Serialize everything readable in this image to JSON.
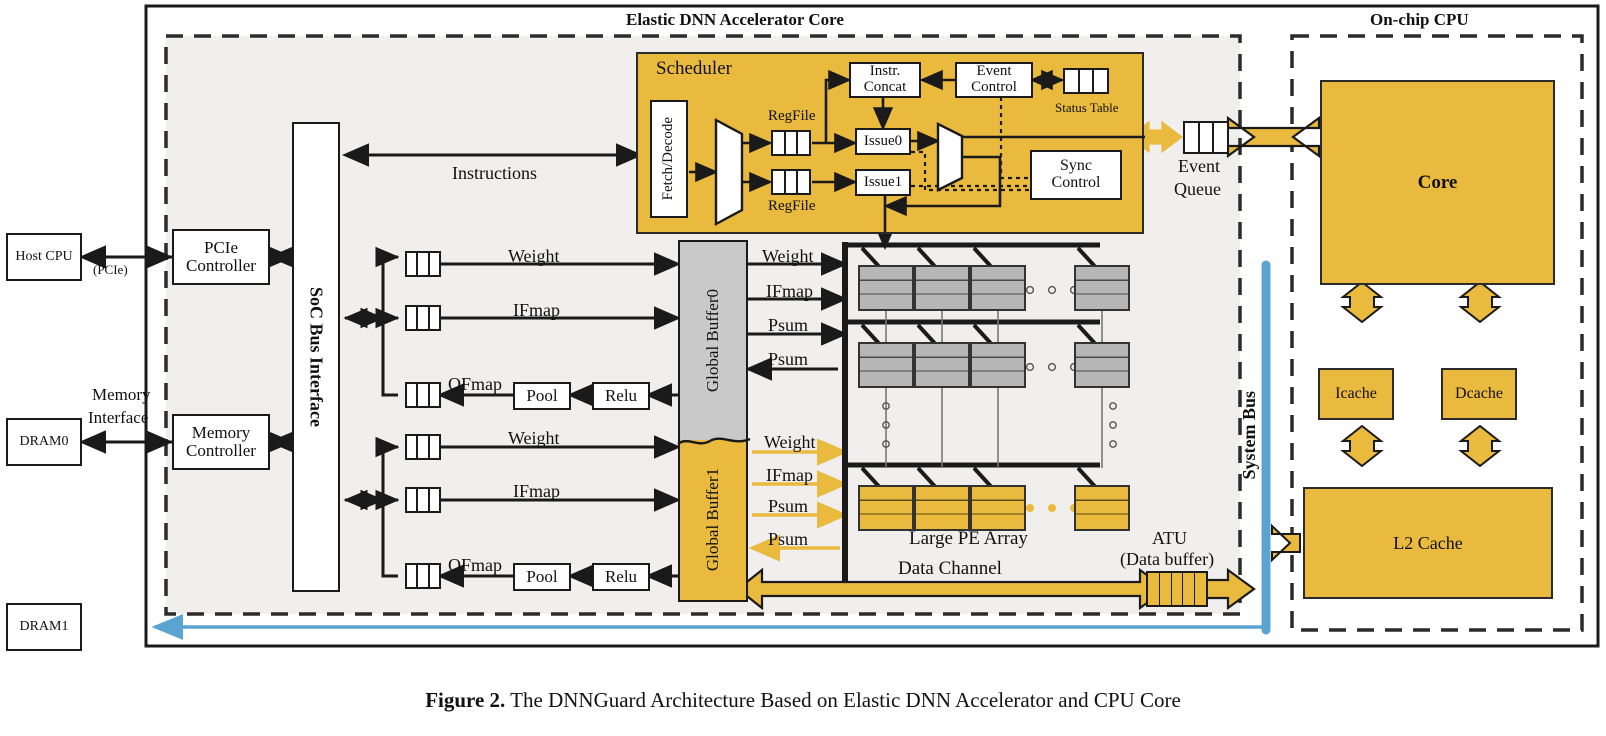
{
  "figure": {
    "caption_bold": "Figure 2.",
    "caption_rest": " The DNNGuard Architecture Based on Elastic DNN Accelerator and CPU Core"
  },
  "regions": {
    "accelerator_title": "Elastic DNN Accelerator Core",
    "cpu_title": "On-chip CPU"
  },
  "external": {
    "host_cpu": "Host CPU",
    "dram0": "DRAM0",
    "dram1": "DRAM1",
    "pcie_note": "(PCIe)",
    "memory_interface_l1": "Memory",
    "memory_interface_l2": "Interface"
  },
  "controllers": {
    "pcie_l1": "PCIe",
    "pcie_l2": "Controller",
    "mem_l1": "Memory",
    "mem_l2": "Controller",
    "soc_bus": "SoC Bus Interface"
  },
  "scheduler": {
    "title": "Scheduler",
    "fetch_decode": "Fetch/Decode",
    "regfile0": "RegFile",
    "regfile1": "RegFile",
    "instr_concat_l1": "Instr.",
    "instr_concat_l2": "Concat",
    "event_control_l1": "Event",
    "event_control_l2": "Control",
    "status_table": "Status Table",
    "issue0": "Issue0",
    "issue1": "Issue1",
    "sync_control_l1": "Sync",
    "sync_control_l2": "Control",
    "regfile_cells": 3,
    "status_cells": 3
  },
  "datapath": {
    "instructions": "Instructions",
    "weight": "Weight",
    "ifmap": "IFmap",
    "psum": "Psum",
    "ofmap": "OFmap",
    "pool": "Pool",
    "relu": "Relu",
    "global_buffer0": "Global Buffer0",
    "global_buffer1": "Global Buffer1",
    "fifo_cells": 3
  },
  "pe": {
    "array_label": "Large PE Array",
    "data_channel": "Data Channel",
    "atu_l1": "ATU",
    "atu_l2": "(Data buffer)",
    "atu_cells": 5
  },
  "cpu": {
    "event_queue_l1": "Event",
    "event_queue_l2": "Queue",
    "event_queue_cells": 3,
    "core": "Core",
    "icache": "Icache",
    "dcache": "Dcache",
    "l2cache": "L2 Cache",
    "system_bus": "System Bus"
  },
  "colors": {
    "gold": "#e9ba3e",
    "pe_gray": "#b6b6b6",
    "panel_gray": "#f0efed",
    "buffer0_gray": "#c9c9c9",
    "system_bus_blue": "#5ba3d0",
    "ink": "#1a1a1a"
  }
}
